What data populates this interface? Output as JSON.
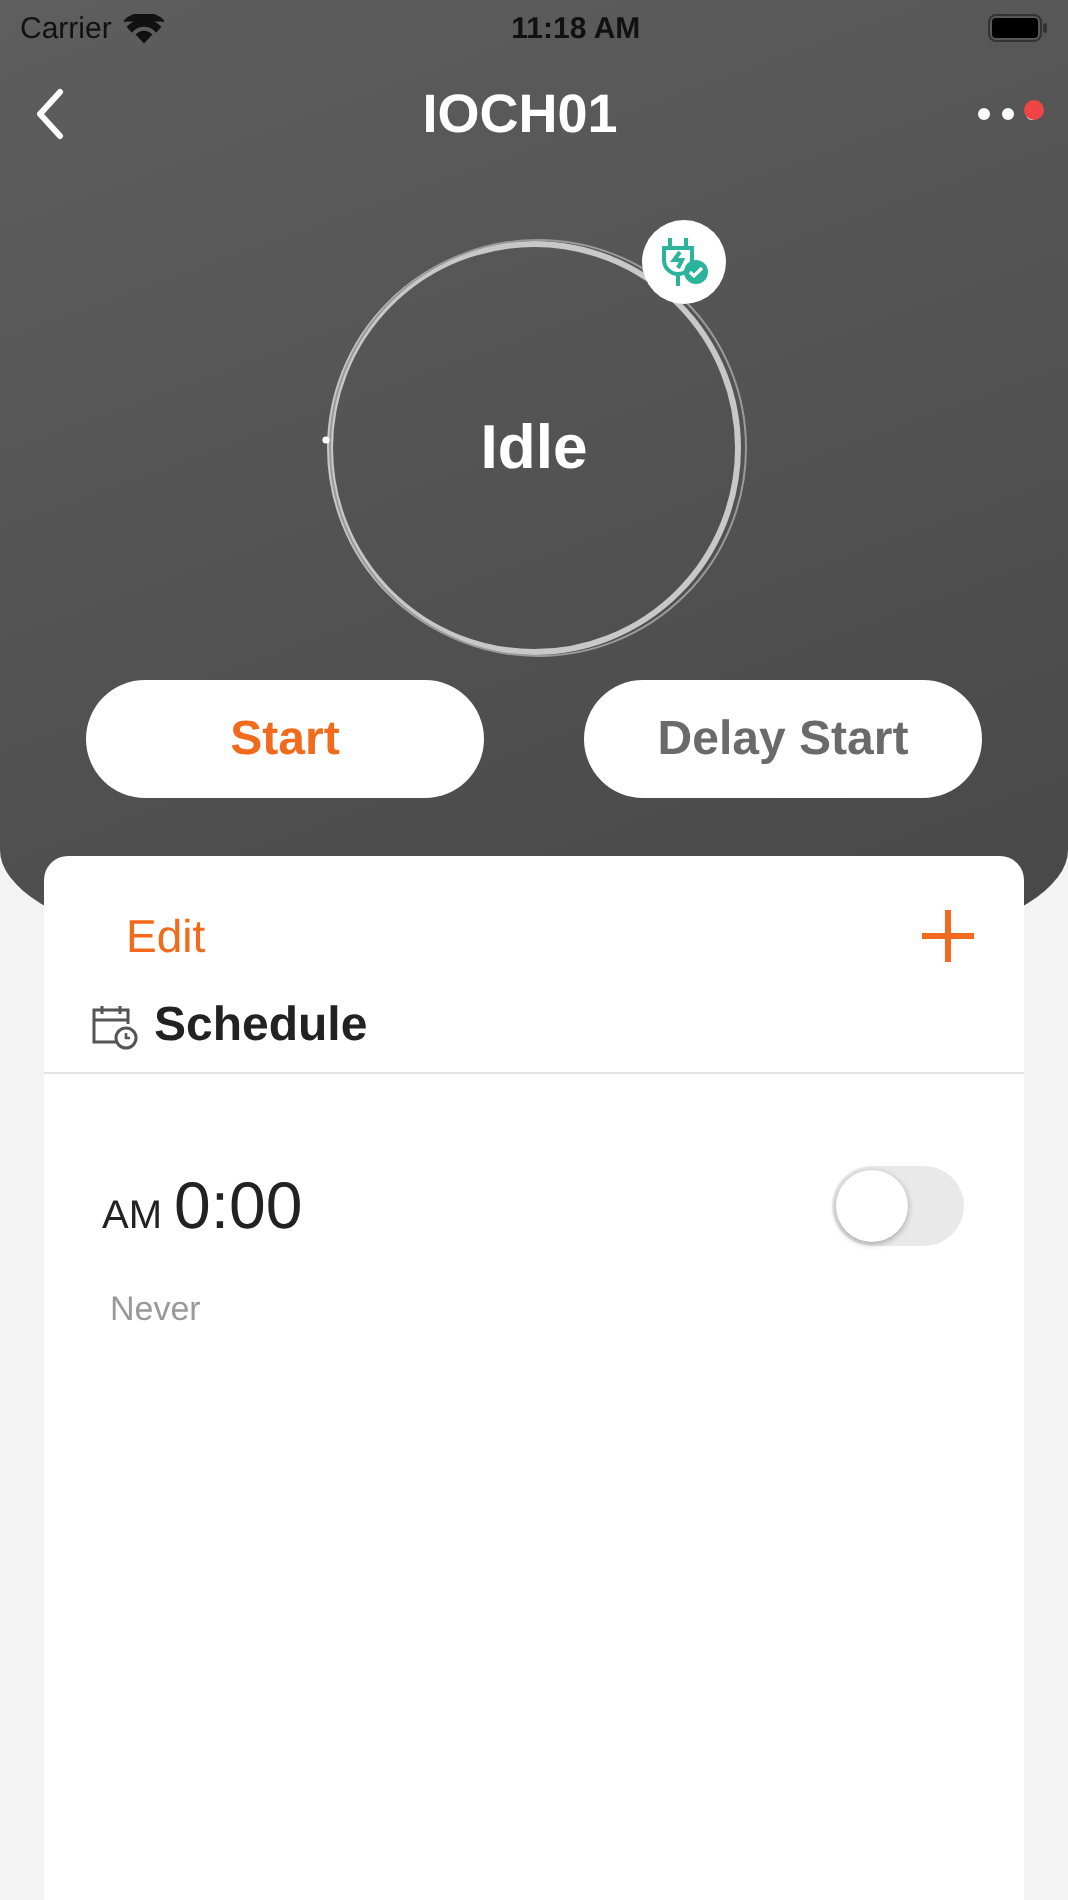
{
  "status_bar": {
    "carrier": "Carrier",
    "time": "11:18 AM"
  },
  "nav": {
    "title": "IOCH01",
    "more_has_alert": true
  },
  "device": {
    "status": "Idle"
  },
  "actions": [
    "Start",
    "Delay Start"
  ],
  "schedule_card": {
    "edit": "Edit",
    "title": "Schedule",
    "items": [
      {
        "period": "AM",
        "time": "0:00",
        "repeat": "Never",
        "on": false
      }
    ]
  }
}
